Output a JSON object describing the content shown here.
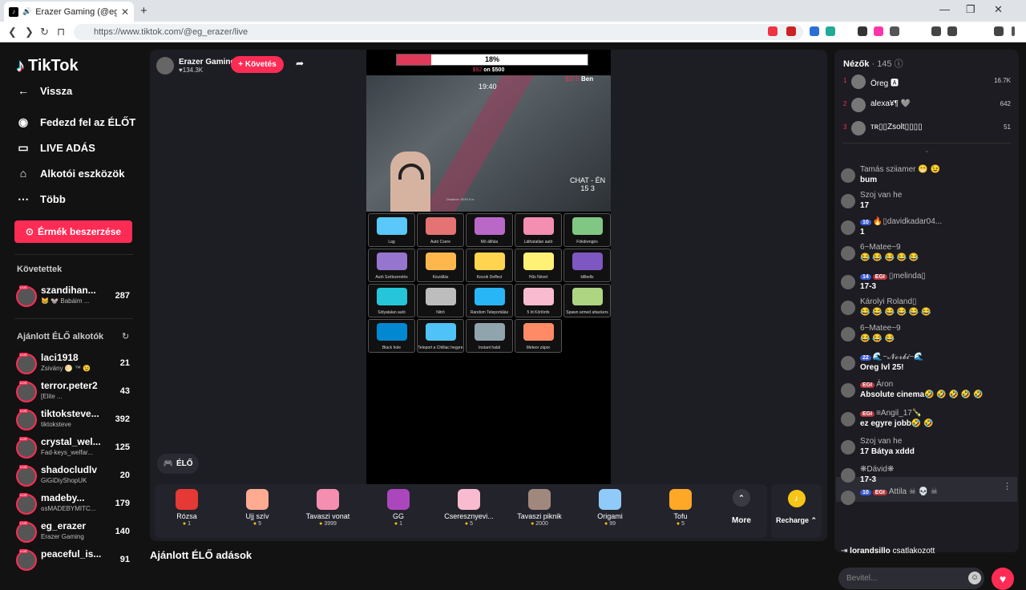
{
  "browser": {
    "tab_title": "Erazer Gaming (@eg_erazer) |",
    "url": "https://www.tiktok.com/@eg_erazer/live"
  },
  "sidebar": {
    "logo": "TikTok",
    "back": "Vissza",
    "nav": [
      {
        "label": "Fedezd fel az ÉLŐT",
        "icon": "live-explore-icon"
      },
      {
        "label": "LIVE ADÁS",
        "icon": "camera-icon"
      },
      {
        "label": "Alkotói eszközök",
        "icon": "creator-tools-icon"
      },
      {
        "label": "Több",
        "icon": "more-dots-icon"
      }
    ],
    "coins_button": "Érmék beszerzése",
    "following_header": "Követettek",
    "following": [
      {
        "name": "szandihan...",
        "sub": "😸 🐭 Babáim ...",
        "count": "287"
      }
    ],
    "recommended_header": "Ajánlott ÉLŐ alkotók",
    "recommended": [
      {
        "name": "laci1918",
        "sub": "Zsivány 🌕 ™ 😉",
        "count": "21"
      },
      {
        "name": "terror.peter2",
        "sub": "[Elite ...",
        "count": "43"
      },
      {
        "name": "tiktoksteve...",
        "sub": "tiktoksteve",
        "count": "392"
      },
      {
        "name": "crystal_wel...",
        "sub": "Fad-keys_welfar...",
        "count": "125"
      },
      {
        "name": "shadocludlv",
        "sub": "GiGiDiyShopUK",
        "count": "20"
      },
      {
        "name": "madeby...",
        "sub": "ɢsMADEBYMITC...",
        "count": "179"
      },
      {
        "name": "eg_erazer",
        "sub": "Erazer Gaming",
        "count": "140"
      },
      {
        "name": "peaceful_is...",
        "sub": "",
        "count": "91"
      }
    ]
  },
  "stream": {
    "streamer_name": "Erazer Gaming",
    "likes": "♥134.3K",
    "follow_button": "+ Követés",
    "progress_text": "18%",
    "progress_fraction": 0.18,
    "goal_prefix": "$92",
    "goal_rest": " on $500",
    "clock": "19:40",
    "right_amount": "$375",
    "right_name": "Ben",
    "chat_label": "CHAT - ÉN",
    "chat_scores": "15      3",
    "distance": "Distance: 6230.9 m",
    "grid": [
      {
        "label": "Lag",
        "color": "#5ac8fa"
      },
      {
        "label": "Autó Csere",
        "color": "#e57373"
      },
      {
        "label": "Mō állítás",
        "color": "#ba68c8"
      },
      {
        "label": "Láthatatlan autó",
        "color": "#f48fb1"
      },
      {
        "label": "Fökdrengés",
        "color": "#81c784"
      },
      {
        "label": "Autó Szétszerelés",
        "color": "#9575cd"
      },
      {
        "label": "Kiszállás",
        "color": "#ffb74d"
      },
      {
        "label": "Kocsik Deffect",
        "color": "#ffd54f"
      },
      {
        "label": "Hűs Nézet",
        "color": "#fff176"
      },
      {
        "label": "killbells",
        "color": "#7e57c2"
      },
      {
        "label": "Sólyatalan autó",
        "color": "#26c6da"
      },
      {
        "label": "Nitrō",
        "color": "#bdbdbd"
      },
      {
        "label": "Random Teleportálás",
        "color": "#29b6f6"
      },
      {
        "label": "5 öt Kōrlönfs",
        "color": "#f8bbd0"
      },
      {
        "label": "Spawn armed attackers",
        "color": "#aed581"
      },
      {
        "label": "Black hole",
        "color": "#0288d1"
      },
      {
        "label": "Teleport a Chilliac hegyre",
        "color": "#4fc3f7"
      },
      {
        "label": "Instant halál",
        "color": "#90a4ae"
      },
      {
        "label": "Meteor zápor",
        "color": "#ff8a65"
      }
    ],
    "live_chip": "ÉLŐ"
  },
  "gifts": [
    {
      "name": "Rózsa",
      "price": "1",
      "color": "#e53935"
    },
    {
      "name": "Ujj szív",
      "price": "5",
      "color": "#ffab91"
    },
    {
      "name": "Tavaszi vonat",
      "price": "3999",
      "color": "#f48fb1"
    },
    {
      "name": "GG",
      "price": "1",
      "color": "#ab47bc"
    },
    {
      "name": "Cseresznyevi...",
      "price": "5",
      "color": "#f8bbd0"
    },
    {
      "name": "Tavaszi piknik",
      "price": "2000",
      "color": "#a1887f"
    },
    {
      "name": "Origami",
      "price": "99",
      "color": "#90caf9"
    },
    {
      "name": "Tofu",
      "price": "5",
      "color": "#ffa726"
    }
  ],
  "more_label": "More",
  "recharge_label": "Recharge ⌃",
  "recommended_title": "Ajánlott ÉLŐ adások",
  "viewers": {
    "header": "Nézők",
    "count": "· 145",
    "top": [
      {
        "rank": "1",
        "name": "Öreg 🅰",
        "score": "16.7K"
      },
      {
        "rank": "2",
        "name": "alexa¥¶ 🩶",
        "score": "642"
      },
      {
        "rank": "3",
        "name": "ᴛʀ▯▯Zsolt▯▯▯▯",
        "score": "51"
      }
    ]
  },
  "chat": [
    {
      "user": "Tamás sziiamer 😁 😉",
      "text": "bum",
      "b1": "",
      "b2": ""
    },
    {
      "user": "Szoj van he",
      "text": "17",
      "b1": "",
      "b2": ""
    },
    {
      "user": "🔥▯davidkadar04...",
      "text": "1",
      "b1": "10",
      "b2": ""
    },
    {
      "user": "6~Matee~9",
      "text": "😂 😂 😂 😂 😂",
      "b1": "",
      "b2": ""
    },
    {
      "user": "▯melinda▯",
      "text": "17-3",
      "b1": "14",
      "b2": "EGI"
    },
    {
      "user": "Károlyi Roland▯",
      "text": "😂 😂 😂 😂 😂 😂",
      "b1": "",
      "b2": ""
    },
    {
      "user": "6~Matee~9",
      "text": "😂 😂 😂",
      "b1": "",
      "b2": ""
    },
    {
      "user": "🌊~𝓝𝓸𝓻𝓫𝓲~🌊",
      "text": "Oreg lvl 25!",
      "b1": "22",
      "b2": ""
    },
    {
      "user": "Áron",
      "text": "Absolute cinema🤣 🤣 🤣 🤣 🤣",
      "b1": "",
      "b2": "EGI"
    },
    {
      "user": "≡Angil_17🍾",
      "text": "ez egyre jobb🤣 🤣",
      "b1": "",
      "b2": "EGI"
    },
    {
      "user": "Szoj van he",
      "text": "17 Bátya xddd",
      "b1": "",
      "b2": ""
    },
    {
      "user": "❋Dávid❋",
      "text": "17-3",
      "b1": "",
      "b2": ""
    },
    {
      "user": "Attila ☠ 💀 ☠",
      "text": "",
      "b1": "10",
      "b2": "EGI"
    }
  ],
  "join": {
    "user": "lorandsillo",
    "text": "csatlakozott"
  },
  "input_placeholder": "Bevitel..."
}
